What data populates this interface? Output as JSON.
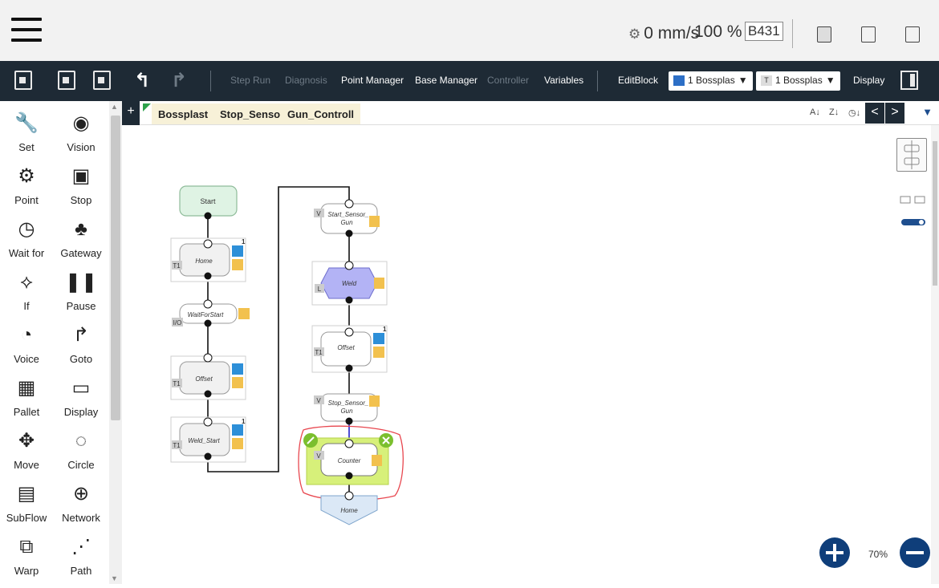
{
  "status": {
    "speed": "0 mm/s",
    "speed_icon": "robot-speed-icon",
    "percent": "100 %",
    "project": "B431"
  },
  "toolbar": {
    "step_run": "Step Run",
    "diagnosis": "Diagnosis",
    "point_manager": "Point Manager",
    "base_manager": "Base Manager",
    "controller": "Controller",
    "variables": "Variables",
    "editblock": "EditBlock",
    "base_select": "1 Bossplas",
    "tool_select": "1 Bossplas",
    "tool_badge": "T",
    "display": "Display"
  },
  "sidebar": {
    "items": [
      {
        "label": "Set",
        "icon": "wrench-icon"
      },
      {
        "label": "Vision",
        "icon": "eye-icon"
      },
      {
        "label": "Point",
        "icon": "robot-arm-icon"
      },
      {
        "label": "Stop",
        "icon": "stop-icon"
      },
      {
        "label": "Wait for",
        "icon": "clock-icon"
      },
      {
        "label": "Gateway",
        "icon": "gateway-icon"
      },
      {
        "label": "If",
        "icon": "branch-icon"
      },
      {
        "label": "Pause",
        "icon": "pause-icon"
      },
      {
        "label": "Voice",
        "icon": "voice-icon"
      },
      {
        "label": "Goto",
        "icon": "goto-icon"
      },
      {
        "label": "Pallet",
        "icon": "grid-icon"
      },
      {
        "label": "Display",
        "icon": "display-icon"
      },
      {
        "label": "Move",
        "icon": "move-icon"
      },
      {
        "label": "Circle",
        "icon": "circle-icon"
      },
      {
        "label": "SubFlow",
        "icon": "subflow-icon"
      },
      {
        "label": "Network",
        "icon": "globe-icon"
      },
      {
        "label": "Warp",
        "icon": "warp-icon"
      },
      {
        "label": "Path",
        "icon": "path-icon"
      }
    ]
  },
  "tabs": {
    "add": "+",
    "items": [
      "Bossplast",
      "Stop_Sensor",
      "Gun_Controll"
    ],
    "prev": "<",
    "next": ">"
  },
  "flow": {
    "start": "Start",
    "home": "Home",
    "wait": "WaitForStart",
    "offset1": "Offset",
    "weld_start": "Weld_Start",
    "start_sensor_1": "Start_Sensor_",
    "start_sensor_2": "Gun",
    "weld": "Weld",
    "offset2": "Offset",
    "stop_sensor_1": "Stop_Sensor_",
    "stop_sensor_2": "Gun",
    "counter": "Counter",
    "goto_home": "Home",
    "tag_t1": "T1",
    "tag_io": "I/O",
    "tag_v": "V",
    "tag_l": "L",
    "count_badge": "1"
  },
  "canvas": {
    "zoom": "70%",
    "highlight_color": "#e8474f"
  }
}
